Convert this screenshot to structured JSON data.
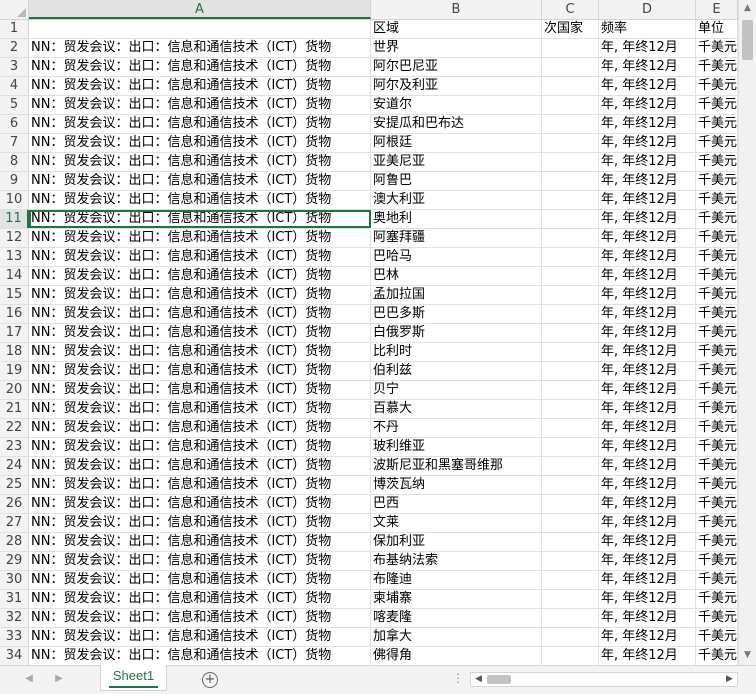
{
  "columns": [
    "A",
    "B",
    "C",
    "D",
    "E"
  ],
  "header_row": {
    "num": "1",
    "a": "",
    "b": "区域",
    "c": "次国家",
    "d": "频率",
    "e": "单位"
  },
  "rows": [
    {
      "num": "2",
      "a": "NN：贸发会议：出口：信息和通信技术（ICT）货物",
      "b": "世界",
      "c": "",
      "d": "年, 年终12月",
      "e": "千美元"
    },
    {
      "num": "3",
      "a": "NN：贸发会议：出口：信息和通信技术（ICT）货物",
      "b": "阿尔巴尼亚",
      "c": "",
      "d": "年, 年终12月",
      "e": "千美元"
    },
    {
      "num": "4",
      "a": "NN：贸发会议：出口：信息和通信技术（ICT）货物",
      "b": "阿尔及利亚",
      "c": "",
      "d": "年, 年终12月",
      "e": "千美元"
    },
    {
      "num": "5",
      "a": "NN：贸发会议：出口：信息和通信技术（ICT）货物",
      "b": "安道尔",
      "c": "",
      "d": "年, 年终12月",
      "e": "千美元"
    },
    {
      "num": "6",
      "a": "NN：贸发会议：出口：信息和通信技术（ICT）货物",
      "b": "安提瓜和巴布达",
      "c": "",
      "d": "年, 年终12月",
      "e": "千美元"
    },
    {
      "num": "7",
      "a": "NN：贸发会议：出口：信息和通信技术（ICT）货物",
      "b": "阿根廷",
      "c": "",
      "d": "年, 年终12月",
      "e": "千美元"
    },
    {
      "num": "8",
      "a": "NN：贸发会议：出口：信息和通信技术（ICT）货物",
      "b": "亚美尼亚",
      "c": "",
      "d": "年, 年终12月",
      "e": "千美元"
    },
    {
      "num": "9",
      "a": "NN：贸发会议：出口：信息和通信技术（ICT）货物",
      "b": "阿鲁巴",
      "c": "",
      "d": "年, 年终12月",
      "e": "千美元"
    },
    {
      "num": "10",
      "a": "NN：贸发会议：出口：信息和通信技术（ICT）货物",
      "b": "澳大利亚",
      "c": "",
      "d": "年, 年终12月",
      "e": "千美元"
    },
    {
      "num": "11",
      "a": "NN：贸发会议：出口：信息和通信技术（ICT）货物",
      "b": "奥地利",
      "c": "",
      "d": "年, 年终12月",
      "e": "千美元"
    },
    {
      "num": "12",
      "a": "NN：贸发会议：出口：信息和通信技术（ICT）货物",
      "b": "阿塞拜疆",
      "c": "",
      "d": "年, 年终12月",
      "e": "千美元"
    },
    {
      "num": "13",
      "a": "NN：贸发会议：出口：信息和通信技术（ICT）货物",
      "b": "巴哈马",
      "c": "",
      "d": "年, 年终12月",
      "e": "千美元"
    },
    {
      "num": "14",
      "a": "NN：贸发会议：出口：信息和通信技术（ICT）货物",
      "b": "巴林",
      "c": "",
      "d": "年, 年终12月",
      "e": "千美元"
    },
    {
      "num": "15",
      "a": "NN：贸发会议：出口：信息和通信技术（ICT）货物",
      "b": "孟加拉国",
      "c": "",
      "d": "年, 年终12月",
      "e": "千美元"
    },
    {
      "num": "16",
      "a": "NN：贸发会议：出口：信息和通信技术（ICT）货物",
      "b": "巴巴多斯",
      "c": "",
      "d": "年, 年终12月",
      "e": "千美元"
    },
    {
      "num": "17",
      "a": "NN：贸发会议：出口：信息和通信技术（ICT）货物",
      "b": "白俄罗斯",
      "c": "",
      "d": "年, 年终12月",
      "e": "千美元"
    },
    {
      "num": "18",
      "a": "NN：贸发会议：出口：信息和通信技术（ICT）货物",
      "b": "比利时",
      "c": "",
      "d": "年, 年终12月",
      "e": "千美元"
    },
    {
      "num": "19",
      "a": "NN：贸发会议：出口：信息和通信技术（ICT）货物",
      "b": "伯利兹",
      "c": "",
      "d": "年, 年终12月",
      "e": "千美元"
    },
    {
      "num": "20",
      "a": "NN：贸发会议：出口：信息和通信技术（ICT）货物",
      "b": "贝宁",
      "c": "",
      "d": "年, 年终12月",
      "e": "千美元"
    },
    {
      "num": "21",
      "a": "NN：贸发会议：出口：信息和通信技术（ICT）货物",
      "b": "百慕大",
      "c": "",
      "d": "年, 年终12月",
      "e": "千美元"
    },
    {
      "num": "22",
      "a": "NN：贸发会议：出口：信息和通信技术（ICT）货物",
      "b": "不丹",
      "c": "",
      "d": "年, 年终12月",
      "e": "千美元"
    },
    {
      "num": "23",
      "a": "NN：贸发会议：出口：信息和通信技术（ICT）货物",
      "b": "玻利维亚",
      "c": "",
      "d": "年, 年终12月",
      "e": "千美元"
    },
    {
      "num": "24",
      "a": "NN：贸发会议：出口：信息和通信技术（ICT）货物",
      "b": "波斯尼亚和黑塞哥维那",
      "c": "",
      "d": "年, 年终12月",
      "e": "千美元"
    },
    {
      "num": "25",
      "a": "NN：贸发会议：出口：信息和通信技术（ICT）货物",
      "b": "博茨瓦纳",
      "c": "",
      "d": "年, 年终12月",
      "e": "千美元"
    },
    {
      "num": "26",
      "a": "NN：贸发会议：出口：信息和通信技术（ICT）货物",
      "b": "巴西",
      "c": "",
      "d": "年, 年终12月",
      "e": "千美元"
    },
    {
      "num": "27",
      "a": "NN：贸发会议：出口：信息和通信技术（ICT）货物",
      "b": "文莱",
      "c": "",
      "d": "年, 年终12月",
      "e": "千美元"
    },
    {
      "num": "28",
      "a": "NN：贸发会议：出口：信息和通信技术（ICT）货物",
      "b": "保加利亚",
      "c": "",
      "d": "年, 年终12月",
      "e": "千美元"
    },
    {
      "num": "29",
      "a": "NN：贸发会议：出口：信息和通信技术（ICT）货物",
      "b": "布基纳法索",
      "c": "",
      "d": "年, 年终12月",
      "e": "千美元"
    },
    {
      "num": "30",
      "a": "NN：贸发会议：出口：信息和通信技术（ICT）货物",
      "b": "布隆迪",
      "c": "",
      "d": "年, 年终12月",
      "e": "千美元"
    },
    {
      "num": "31",
      "a": "NN：贸发会议：出口：信息和通信技术（ICT）货物",
      "b": "柬埔寨",
      "c": "",
      "d": "年, 年终12月",
      "e": "千美元"
    },
    {
      "num": "32",
      "a": "NN：贸发会议：出口：信息和通信技术（ICT）货物",
      "b": "喀麦隆",
      "c": "",
      "d": "年, 年终12月",
      "e": "千美元"
    },
    {
      "num": "33",
      "a": "NN：贸发会议：出口：信息和通信技术（ICT）货物",
      "b": "加拿大",
      "c": "",
      "d": "年, 年终12月",
      "e": "千美元"
    },
    {
      "num": "34",
      "a": "NN：贸发会议：出口：信息和通信技术（ICT）货物",
      "b": "佛得角",
      "c": "",
      "d": "年, 年终12月",
      "e": "千美元"
    }
  ],
  "active_cell": "A11",
  "active_row_num": "11",
  "active_column": "A",
  "sheet_tabs": [
    {
      "label": "Sheet1",
      "active": true
    }
  ],
  "add_sheet_symbol": "+",
  "split_dots": "⋮",
  "colors": {
    "accent": "#217346",
    "header_bg": "#f3f3f3",
    "gridline": "#e1e1e1"
  }
}
